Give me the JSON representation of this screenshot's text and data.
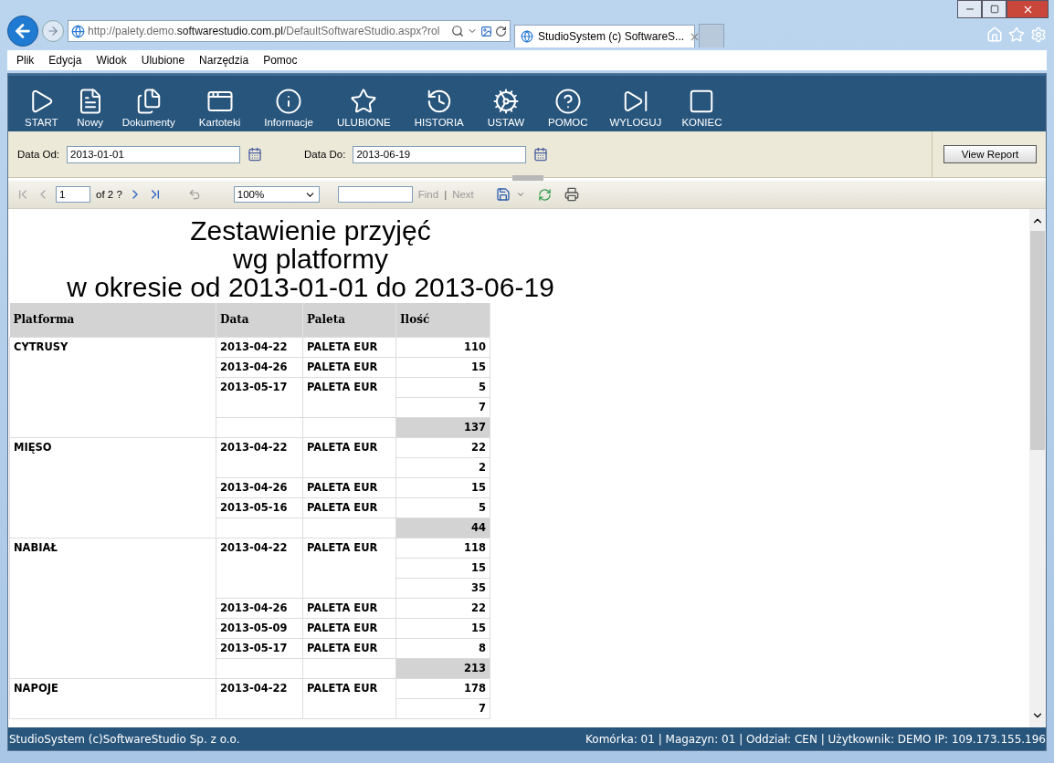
{
  "browser": {
    "address": "http://palety.demo.**softwarestudio.com.pl**/DefaultSoftwareStudio.aspx?rol",
    "tab_title": "StudioSystem (c) SoftwareS...",
    "menu": [
      "Plik",
      "Edycja",
      "Widok",
      "Ulubione",
      "Narzędzia",
      "Pomoc"
    ]
  },
  "toolbar": [
    {
      "kind": "start",
      "label": "START"
    },
    {
      "kind": "new",
      "label": "Nowy"
    },
    {
      "kind": "documents",
      "label": "Dokumenty"
    },
    {
      "kind": "records",
      "label": "Kartoteki"
    },
    {
      "kind": "info",
      "label": "Informacje"
    },
    {
      "kind": "favorites",
      "label": "ULUBIONE"
    },
    {
      "kind": "history",
      "label": "HISTORIA"
    },
    {
      "kind": "settings",
      "label": "USTAW"
    },
    {
      "kind": "help",
      "label": "POMOC"
    },
    {
      "kind": "logout",
      "label": "WYLOGUJ"
    },
    {
      "kind": "exit",
      "label": "KONIEC"
    }
  ],
  "filters": {
    "date_from_label": "Data Od:",
    "date_from": "2013-01-01",
    "date_to_label": "Data Do:",
    "date_to": "2013-06-19",
    "button": "View Report"
  },
  "report_toolbar": {
    "nav_buttons": [
      {
        "kind": "first",
        "disabled": true
      },
      {
        "kind": "previous",
        "disabled": true
      },
      {
        "kind": "next",
        "disabled": false
      },
      {
        "kind": "last",
        "disabled": false
      }
    ],
    "page": "1",
    "page_count": "of 2 ?",
    "zoom": "100%",
    "find": {
      "label": "Find",
      "disabled": true
    },
    "separator": "|",
    "next": {
      "label": "Next",
      "disabled": true
    }
  },
  "report": {
    "title_lines": [
      "Zestawienie przyjęć",
      "wg platformy",
      "w okresie od 2013-01-01 do 2013-06-19"
    ],
    "columns": [
      "Platforma",
      "Data",
      "Paleta",
      "Ilość"
    ],
    "groups": [
      {
        "platform": "CYTRUSY",
        "entries": [
          {
            "date": "2013-04-22",
            "pallet": "PALETA EUR",
            "quantities": [
              "110"
            ]
          },
          {
            "date": "2013-04-26",
            "pallet": "PALETA EUR",
            "quantities": [
              "15"
            ]
          },
          {
            "date": "2013-05-17",
            "pallet": "PALETA EUR",
            "quantities": [
              "5",
              "7"
            ]
          }
        ],
        "total": "137"
      },
      {
        "platform": "MIĘSO",
        "entries": [
          {
            "date": "2013-04-22",
            "pallet": "PALETA EUR",
            "quantities": [
              "22",
              "2"
            ]
          },
          {
            "date": "2013-04-26",
            "pallet": "PALETA EUR",
            "quantities": [
              "15"
            ]
          },
          {
            "date": "2013-05-16",
            "pallet": "PALETA EUR",
            "quantities": [
              "5"
            ]
          }
        ],
        "total": "44"
      },
      {
        "platform": "NABIAŁ",
        "entries": [
          {
            "date": "2013-04-22",
            "pallet": "PALETA EUR",
            "quantities": [
              "118",
              "15",
              "35"
            ]
          },
          {
            "date": "2013-04-26",
            "pallet": "PALETA EUR",
            "quantities": [
              "22"
            ]
          },
          {
            "date": "2013-05-09",
            "pallet": "PALETA EUR",
            "quantities": [
              "15"
            ]
          },
          {
            "date": "2013-05-17",
            "pallet": "PALETA EUR",
            "quantities": [
              "8"
            ]
          }
        ],
        "total": "213"
      },
      {
        "platform": "NAPOJE",
        "entries": [
          {
            "date": "2013-04-22",
            "pallet": "PALETA EUR",
            "quantities": [
              "178",
              "7"
            ]
          }
        ]
      }
    ]
  },
  "status_bar": {
    "left": "StudioSystem (c)SoftwareStudio Sp. z o.o.",
    "right": "Komórka: 01 | Magazyn: 01 | Oddział: CEN | Użytkownik: DEMO IP: 109.173.155.196"
  }
}
